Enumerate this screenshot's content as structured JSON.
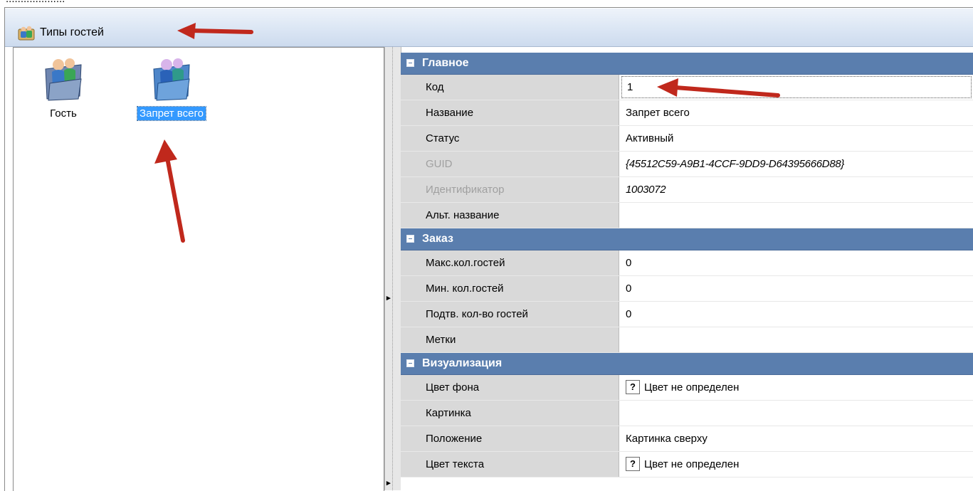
{
  "header": {
    "title": "Типы гостей",
    "cut_text": "...................."
  },
  "left_pane": {
    "items": [
      {
        "label": "Гость",
        "selected": false,
        "icon": "guest-type-icon"
      },
      {
        "label": "Запрет всего",
        "selected": true,
        "icon": "guest-type-icon"
      }
    ]
  },
  "property_grid": {
    "categories": [
      {
        "label": "Главное",
        "rows": [
          {
            "name": "Код",
            "value": "1"
          },
          {
            "name": "Название",
            "value": "Запрет всего"
          },
          {
            "name": "Статус",
            "value": "Активный"
          },
          {
            "name": "GUID",
            "value": "{45512C59-A9B1-4CCF-9DD9-D64395666D88}"
          },
          {
            "name": "Идентификатор",
            "value": "1003072"
          },
          {
            "name": "Альт. название",
            "value": ""
          }
        ]
      },
      {
        "label": "Заказ",
        "rows": [
          {
            "name": "Макс.кол.гостей",
            "value": "0"
          },
          {
            "name": "Мин. кол.гостей",
            "value": "0"
          },
          {
            "name": "Подтв. кол-во гостей",
            "value": "0"
          },
          {
            "name": "Метки",
            "value": ""
          }
        ]
      },
      {
        "label": "Визуализация",
        "rows": [
          {
            "name": "Цвет фона",
            "value": "Цвет не определен",
            "prefix": "?"
          },
          {
            "name": "Картинка",
            "value": ""
          },
          {
            "name": "Положение",
            "value": "Картинка сверху"
          },
          {
            "name": "Цвет текста",
            "value": "Цвет не определен",
            "prefix": "?"
          }
        ]
      }
    ]
  },
  "colors": {
    "category_header": "#5a7eae",
    "selection": "#3399ff",
    "annotation_arrow": "#c0281c"
  }
}
